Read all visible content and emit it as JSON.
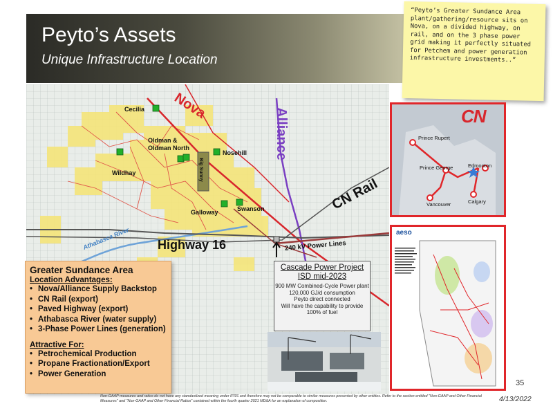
{
  "header": {
    "title": "Peyto’s Assets",
    "subtitle": "Unique Infrastructure Location"
  },
  "sticky_note": {
    "text": "“Peyto’s Greater Sundance Area plant/gathering/resource sits on Nova, on a divided highway, on rail, and on the 3 phase power grid making it perfectly situated for Petchem and power generation infrastructure investments..”"
  },
  "map": {
    "labels": {
      "nova": "Nova",
      "alliance": "Alliance",
      "cn_rail": "CN Rail",
      "highway": "Highway 16",
      "power_lines": "240 kV Power Lines",
      "athabasca": "Athabasca River",
      "big_sunny": "Big Sunny",
      "cecilia": "Cecilia",
      "oldman": "Oldman & Oldman North",
      "nosehill": "Nosehill",
      "wildhay": "Wildhay",
      "galloway": "Galloway",
      "swanson": "Swanson"
    },
    "colors": {
      "nova": "#d8262c",
      "alliance": "#7a3fc2",
      "power": "#9a3b3b",
      "yellow": "#f5e57a",
      "plant": "#22b02a"
    }
  },
  "cn_panel": {
    "logo": "CN",
    "cities": [
      "Prince Rupert",
      "Prince George",
      "Edmonton",
      "Vancouver",
      "Calgary"
    ]
  },
  "aeso_panel": {
    "logo": "aeso"
  },
  "info_box": {
    "heading": "Greater Sundance Area",
    "advantages_title": "Location Advantages:",
    "advantages": [
      "Nova/Alliance Supply Backstop",
      "CN Rail (export)",
      "Paved Highway (export)",
      "Athabasca River (water supply)",
      "3-Phase Power Lines (generation)"
    ],
    "attractive_title": "Attractive For:",
    "attractive": [
      "Petrochemical Production",
      "Propane Fractionation/Export",
      "Power Generation"
    ]
  },
  "cascade": {
    "title": "Cascade Power Project",
    "subtitle": "ISD mid-2023",
    "bullets": [
      "900 MW Combined-Cycle Power plant",
      "120,000 GJ/d consumption",
      "Peyto direct connected",
      "Will have the capability to provide 100% of fuel"
    ]
  },
  "footer": {
    "footnote": "Non-GAAP measures and ratios do not have any standardized meaning under IFRS and therefore may not be comparable to similar measures presented by other entities. Refer to the section entitled \"Non-GAAP and Other Financial Measures\" and \"Non-GAAP and Other Financial Ratios\" contained within the fourth quarter 2021 MD&A for an explanation of composition.",
    "page_number": "35",
    "date": "4/13/2022"
  }
}
